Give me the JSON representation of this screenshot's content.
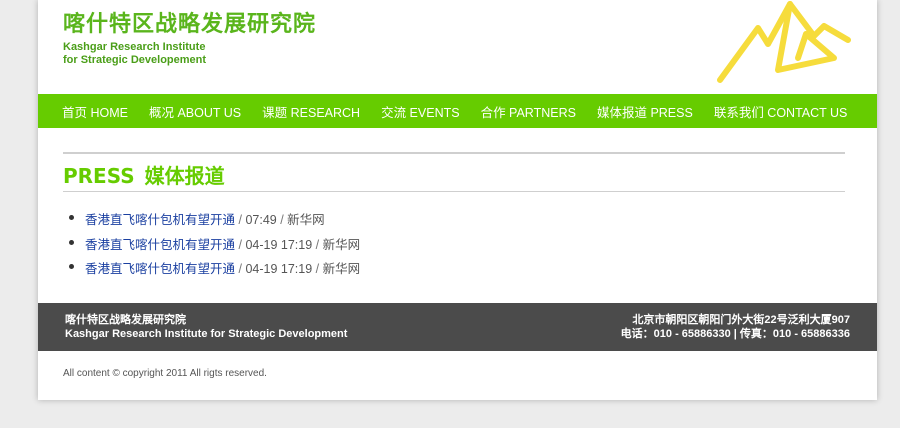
{
  "header": {
    "logo_cn": "喀什特区战略发展研究院",
    "logo_en_line1": "Kashgar Research Institute",
    "logo_en_line2": "for Strategic Developement"
  },
  "nav": [
    {
      "label": "首页 HOME"
    },
    {
      "label": "概况 ABOUT US"
    },
    {
      "label": "课题 RESEARCH"
    },
    {
      "label": "交流 EVENTS"
    },
    {
      "label": "合作 PARTNERS"
    },
    {
      "label": "媒体报道 PRESS"
    },
    {
      "label": "联系我们 CONTACT US"
    }
  ],
  "section": {
    "title_en": "PRESS",
    "title_cn": "媒体报道"
  },
  "news": [
    {
      "title": "香港直飞喀什包机有望开通",
      "date": "07:49",
      "source": "新华网"
    },
    {
      "title": "香港直飞喀什包机有望开通",
      "date": "04-19 17:19",
      "source": "新华网"
    },
    {
      "title": "香港直飞喀什包机有望开通",
      "date": "04-19 17:19",
      "source": "新华网"
    }
  ],
  "footer": {
    "org_cn": "喀什特区战略发展研究院",
    "org_en": "Kashgar Research Institute for Strategic Development",
    "address": "北京市朝阳区朝阳门外大街22号泛利大厦907",
    "phone": "电话：010 - 65886330 | 传真：010 - 65886336"
  },
  "copyright": "All content © copyright 2011 All rigts reserved.",
  "colors": {
    "nav_bg": "#66cc00",
    "title": "#66cc00",
    "logo": "#5ab51c",
    "link": "#1a3fa0",
    "footer_bg": "#4b4b4b",
    "mountain": "#f6dc3c"
  }
}
